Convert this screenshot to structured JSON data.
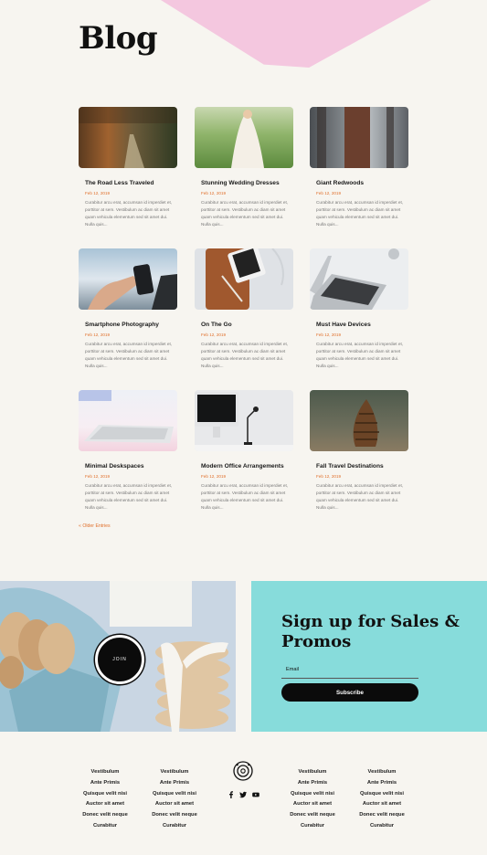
{
  "page_title": "Blog",
  "excerpt": "Curabitur arcu erat, accumsan id imperdiet et, porttitor at sem. Vestibulum ac diam sit amet quam vehicula elementum sed sit amet dui. Nulla quis...",
  "posts": [
    {
      "title": "The Road Less Traveled",
      "date": "Feb 12, 2019",
      "image": "forest-road-photo"
    },
    {
      "title": "Stunning Wedding Dresses",
      "date": "Feb 12, 2019",
      "image": "wedding-dress-photo"
    },
    {
      "title": "Giant Redwoods",
      "date": "Feb 12, 2019",
      "image": "redwood-trees-photo"
    },
    {
      "title": "Smartphone Photography",
      "date": "Feb 12, 2019",
      "image": "smartphone-photo"
    },
    {
      "title": "On The Go",
      "date": "Feb 12, 2019",
      "image": "phone-on-leather-photo"
    },
    {
      "title": "Must Have Devices",
      "date": "Feb 12, 2019",
      "image": "laptop-keyboard-photo"
    },
    {
      "title": "Minimal Deskspaces",
      "date": "Feb 12, 2019",
      "image": "keyboard-desk-photo"
    },
    {
      "title": "Modern Office Arrangements",
      "date": "Feb 12, 2019",
      "image": "office-monitor-photo"
    },
    {
      "title": "Fall Travel Destinations",
      "date": "Feb 12, 2019",
      "image": "pinecone-photo"
    }
  ],
  "older_entries": "« Older Entries",
  "promo": {
    "join_label": "JOIN",
    "image": "cookies-and-milk-photo"
  },
  "signup": {
    "title": "Sign up for Sales & Promos",
    "email_label": "Email",
    "subscribe_label": "Subscribe"
  },
  "footer": {
    "columns": [
      [
        "Vestibulum",
        "Ante Primis",
        "Quisque velit nisi",
        "Auctor sit amet",
        "Donec velit neque",
        "Curabitur"
      ],
      [
        "Vestibulum",
        "Ante Primis",
        "Quisque velit nisi",
        "Auctor sit amet",
        "Donec velit neque",
        "Curabitur"
      ],
      [
        "Vestibulum",
        "Ante Primis",
        "Quisque velit nisi",
        "Auctor sit amet",
        "Donec velit neque",
        "Curabitur"
      ],
      [
        "Vestibulum",
        "Ante Primis",
        "Quisque velit nisi",
        "Auctor sit amet",
        "Donec velit neque",
        "Curabitur"
      ]
    ],
    "logo_icon": "donut-logo-icon",
    "social_icons": [
      "facebook-icon",
      "twitter-icon",
      "youtube-icon"
    ]
  },
  "colors": {
    "accent": "#e0702c",
    "pink": "#f4c7df",
    "teal": "#87dcdb",
    "background": "#f7f5f0"
  }
}
